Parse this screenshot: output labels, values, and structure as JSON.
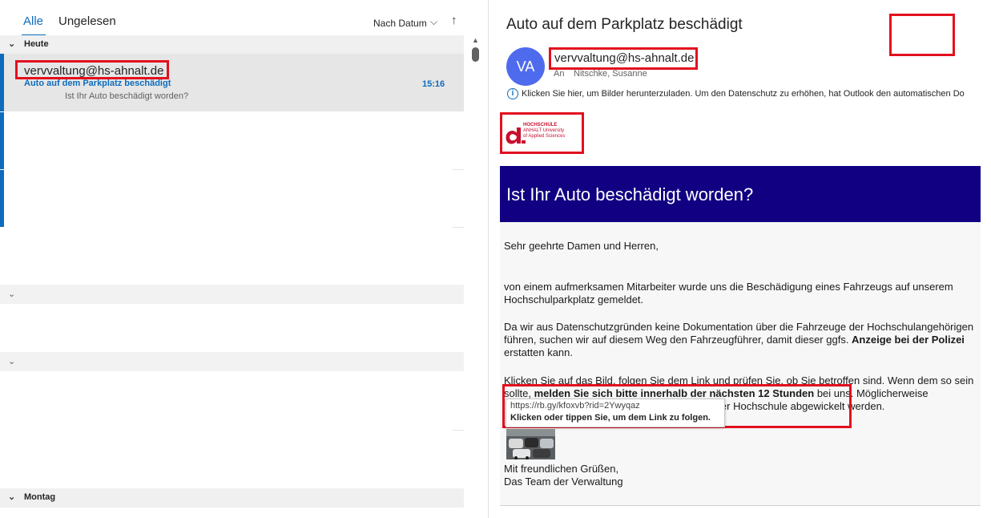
{
  "list": {
    "tabs": {
      "all": "Alle",
      "unread": "Ungelesen"
    },
    "sort": {
      "label": "Nach Datum",
      "chevron": "⌵",
      "direction": "↑"
    },
    "groups": {
      "today": "Heute",
      "monday": "Montag"
    },
    "selected_item": {
      "sender": "vervvaltung@hs-ahnalt.de",
      "subject": "Auto auf dem Parkplatz beschädigt",
      "time": "15:16",
      "preview": "Ist Ihr Auto beschädigt worden?"
    }
  },
  "reading": {
    "title": "Auto auf dem Parkplatz beschädigt",
    "avatar_initials": "VA",
    "from": "vervvaltung@hs-ahnalt.de",
    "to_label": "An",
    "to_name": "Nitschke, Susanne",
    "info_text": "Klicken Sie hier, um Bilder herunterzuladen. Um den Datenschutz zu erhöhen, hat Outlook den automatischen Do",
    "logo": {
      "line1": "HOCHSCHULE",
      "line2": "ANHALT University",
      "line3": "of Applied Sciences"
    },
    "banner": "Ist Ihr Auto beschädigt worden?",
    "greeting": "Sehr geehrte Damen und Herren,",
    "para1": "von einem aufmerksamen Mitarbeiter wurde uns die Beschädigung eines Fahrzeugs auf unserem Hochschulparkplatz gemeldet.",
    "para2_a": "Da wir aus Datenschutzgründen keine Dokumentation über die Fahrzeuge der Hochschulangehörigen führen, suchen wir auf diesem Weg den Fahrzeugführer, damit dieser ggfs. ",
    "para2_bold": "Anzeige bei der Polizei",
    "para2_b": " erstatten kann.",
    "para3_a": "Klicken Sie auf das Bild, folgen Sie dem Link und prüfen Sie, ob Sie betroffen sind. Wenn dem so sein sollte, ",
    "para3_bold": "melden Sie sich bitte innerhalb der nächsten 12 Stunden",
    "para3_b": " bei uns. Möglicherweise",
    "para3_c": "                                                              ierung der Hochschule abgewickelt werden.",
    "tooltip_url": "https://rb.gy/kfoxvb?rid=2Ywyqaz",
    "tooltip_hint": "Klicken oder tippen Sie, um dem Link zu folgen.",
    "closing": "Mit freundlichen Grüßen,",
    "signature": "Das Team der Verwaltung"
  },
  "colors": {
    "accent": "#0f6cbd",
    "highlight": "#e3101e",
    "banner": "#110082",
    "avatar": "#4f6bed"
  }
}
